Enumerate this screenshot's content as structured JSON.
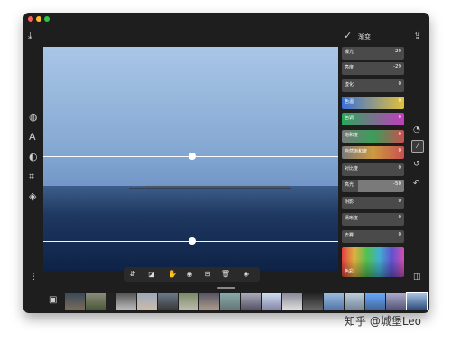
{
  "panel": {
    "title": "渐变",
    "sliders": [
      {
        "label": "曝光",
        "value": "-29",
        "colors": "#4a4a4a,#4a4a4a"
      },
      {
        "label": "亮度",
        "value": "-29",
        "colors": "#4a4a4a,#4a4a4a"
      },
      {
        "label": "虚化",
        "value": "0",
        "colors": "#4a4a4a,#4a4a4a"
      },
      {
        "label": "色温",
        "value": "0",
        "colors": "#3a70d8,#e2c13a"
      },
      {
        "label": "色调",
        "value": "0",
        "colors": "#2aa85a,#c23dbd"
      },
      {
        "label": "饱和度",
        "value": "0",
        "colors": "#7a7a7a,#c85050"
      },
      {
        "label": "自然饱和度",
        "value": "0",
        "colors": "#7a7a7a,#cc9a40"
      },
      {
        "label": "对比度",
        "value": "0",
        "colors": "#4a4a4a,#4a4a4a"
      },
      {
        "label": "高光",
        "value": "-50",
        "colors": "#4a4a4a,#4a4a4a"
      },
      {
        "label": "阴影",
        "value": "0",
        "colors": "#4a4a4a,#4a4a4a"
      },
      {
        "label": "清晰度",
        "value": "0",
        "colors": "#4a4a4a,#4a4a4a"
      },
      {
        "label": "去雾",
        "value": "0",
        "colors": "#4a4a4a,#4a4a4a"
      }
    ],
    "color_swatch_label": "色彩"
  },
  "watermark": "知乎 @城堡Leo",
  "colors": {
    "window_bg": "#1e1e1e",
    "panel_slider": "#4a4a4a"
  },
  "icons": [
    "download-icon",
    "share-icon",
    "check-icon",
    "gradient-icon",
    "heal-icon",
    "text-icon",
    "mask-icon",
    "crop-icon",
    "layers-icon",
    "more-icon",
    "history-icon",
    "undo-icon",
    "compare-icon"
  ]
}
